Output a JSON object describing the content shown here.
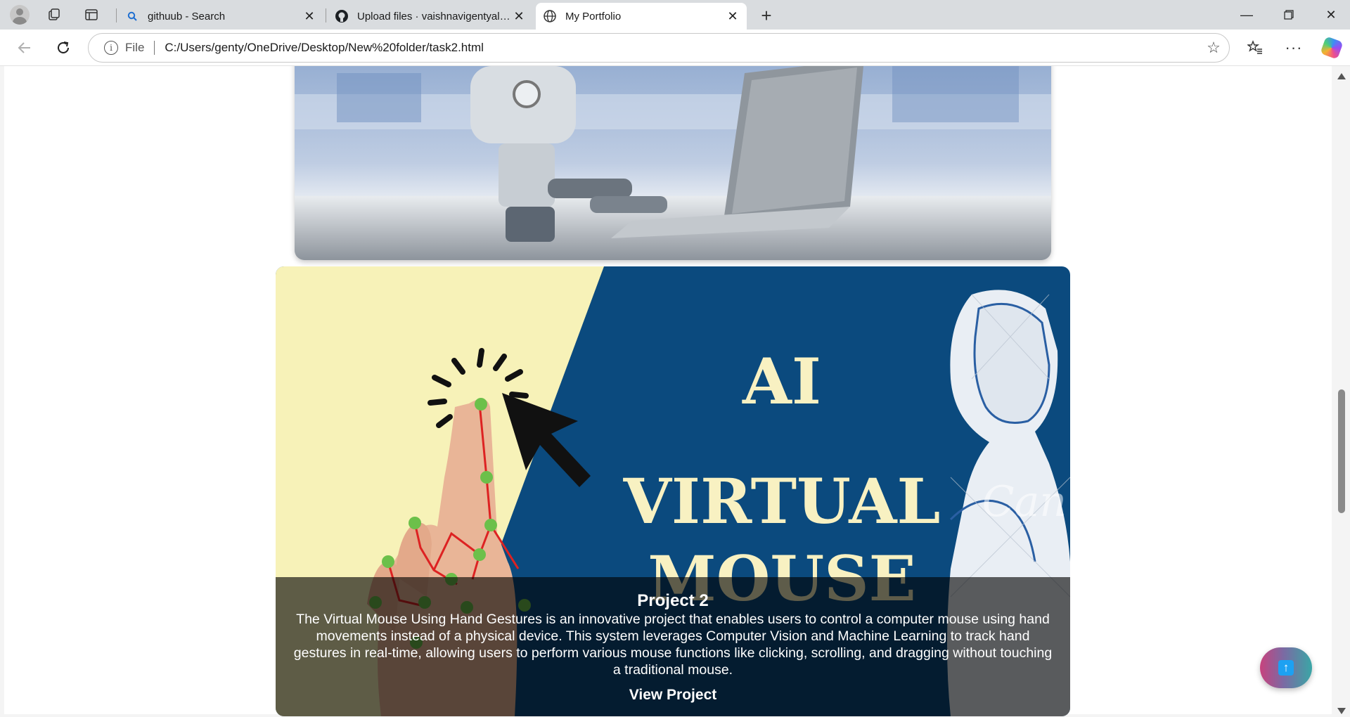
{
  "browser": {
    "tabs": [
      {
        "label": "githuub - Search",
        "icon": "search-icon"
      },
      {
        "label": "Upload files · vaishnavigentyala/W",
        "icon": "github-icon"
      },
      {
        "label": "My Portfolio",
        "icon": "globe-icon"
      }
    ],
    "address": {
      "scheme": "File",
      "url": "C:/Users/genty/OneDrive/Desktop/New%20folder/task2.html"
    }
  },
  "page": {
    "project_card": {
      "image_text": [
        "AI",
        "VIRTUAL",
        "MOUSE"
      ],
      "title": "Project 2",
      "description": "The Virtual Mouse Using Hand Gestures is an innovative project that enables users to control a computer mouse using hand movements instead of a physical device. This system leverages Computer Vision and Machine Learning to track hand gestures in real-time, allowing users to perform various mouse functions like clicking, scrolling, and dragging without touching a traditional mouse.",
      "link_label": "View Project",
      "watermark": "Can"
    },
    "scroll_top": {
      "icon": "arrow-up-icon"
    }
  },
  "colors": {
    "navy": "#0b4a7e",
    "cream": "#f7f2b8",
    "title_gold": "#f8f1c2",
    "button_gradient": [
      "#c8427d",
      "#3aa6a6"
    ]
  }
}
